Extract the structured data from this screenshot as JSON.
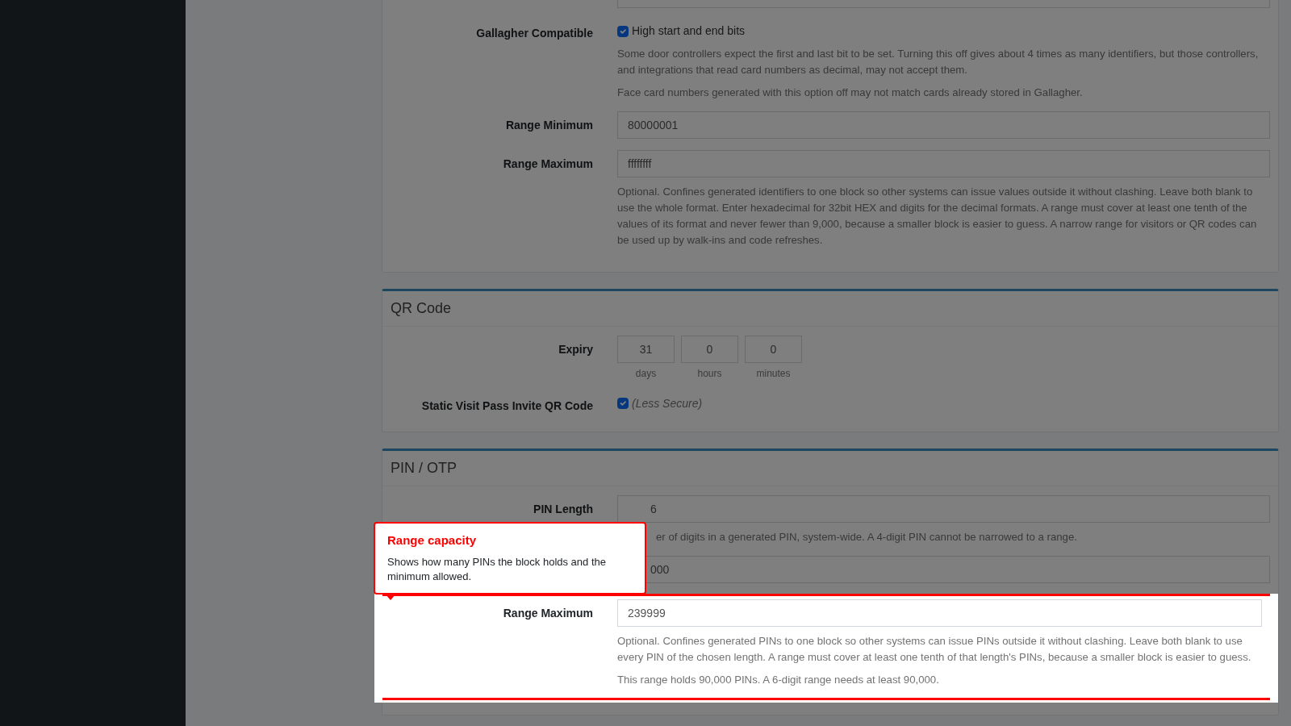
{
  "sections": [
    {
      "fields": [
        {
          "kind": "input",
          "highlighted": false
        },
        {
          "kind": "checkbox",
          "label": "Gallagher Compatible",
          "text": "High start and end bits",
          "checked": true,
          "highlighted": false,
          "help": [
            "Some door controllers expect the first and last bit to be set. Turning this off gives about 4 times as many identifiers, but those controllers, and integrations that read card numbers as decimal, may not accept them.",
            "Face card numbers generated with this option off may not match cards already stored in Gallagher."
          ]
        },
        {
          "kind": "input",
          "label": "Range Minimum",
          "value": "80000001",
          "highlighted": false
        },
        {
          "kind": "input",
          "label": "Range Maximum",
          "value": "ffffffff",
          "highlighted": false,
          "help": [
            "Optional. Confines generated identifiers to one block so other systems can issue values outside it without clashing. Leave both blank to use the whole format. Enter hexadecimal for 32bit HEX and digits for the decimal formats. A range must cover at least one tenth of the values of its format and never fewer than 9,000, because a smaller block is easier to guess. A narrow range for visitors or QR codes can be used up by walk-ins and code refreshes."
          ]
        }
      ]
    },
    {
      "title": "QR Code",
      "fields": [
        {
          "kind": "duration",
          "label": "Expiry",
          "highlighted": false,
          "parts": [
            {
              "value": "31",
              "unit": "days"
            },
            {
              "value": "0",
              "unit": "hours"
            },
            {
              "value": "0",
              "unit": "minutes"
            }
          ]
        },
        {
          "kind": "checkbox-note",
          "label": "Static Visit Pass Invite QR Code",
          "text": "(Less Secure)",
          "checked": true,
          "highlighted": false
        }
      ]
    },
    {
      "title": "PIN / OTP",
      "fields": [
        {
          "kind": "input",
          "label": "PIN Length",
          "value": "6",
          "highlighted": false,
          "help": [
            "er of digits in a generated PIN, system-wide. A 4-digit PIN cannot be narrowed to a range."
          ]
        },
        {
          "kind": "input",
          "value": "000",
          "highlighted": false
        },
        {
          "kind": "input",
          "label": "Range Maximum",
          "value": "239999",
          "highlighted": true,
          "help": [
            "Optional. Confines generated PINs to one block so other systems can issue PINs outside it without clashing. Leave both blank to use every PIN of the chosen length. A range must cover at least one tenth of that length's PINs, because a smaller block is easier to guess.",
            "This range holds 90,000 PINs. A 6-digit range needs at least 90,000."
          ]
        }
      ]
    }
  ],
  "tour": {
    "title": "Range capacity",
    "body": "Shows how many PINs the block holds and the minimum allowed."
  }
}
